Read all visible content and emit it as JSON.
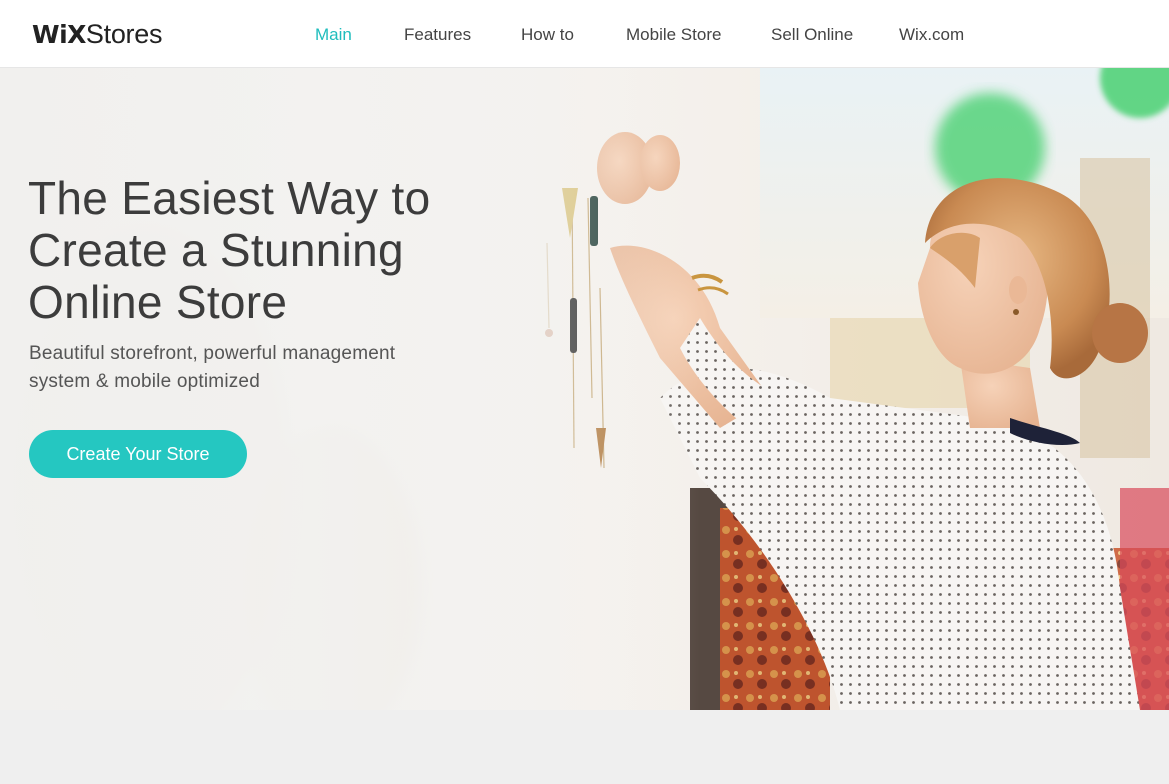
{
  "header": {
    "logo": {
      "wix": "WiX",
      "stores": "Stores"
    },
    "nav": [
      {
        "label": "Main",
        "active": true
      },
      {
        "label": "Features",
        "active": false
      },
      {
        "label": "How to",
        "active": false
      },
      {
        "label": "Mobile Store",
        "active": false
      },
      {
        "label": "Sell Online",
        "active": false
      },
      {
        "label": "Wix.com",
        "active": false
      }
    ]
  },
  "hero": {
    "title_lines": [
      "The Easiest Way to",
      "Create a Stunning",
      "Online Store"
    ],
    "subtitle_lines": [
      "Beautiful storefront, powerful management",
      "system & mobile optimized"
    ],
    "cta_label": "Create Your Store",
    "image_subject": "woman-hanging-jewelry-photo"
  },
  "colors": {
    "accent": "#1fbdbd",
    "button": "#25c7c1",
    "text_dark": "#3c3c3c",
    "page_bg": "#efefef"
  }
}
